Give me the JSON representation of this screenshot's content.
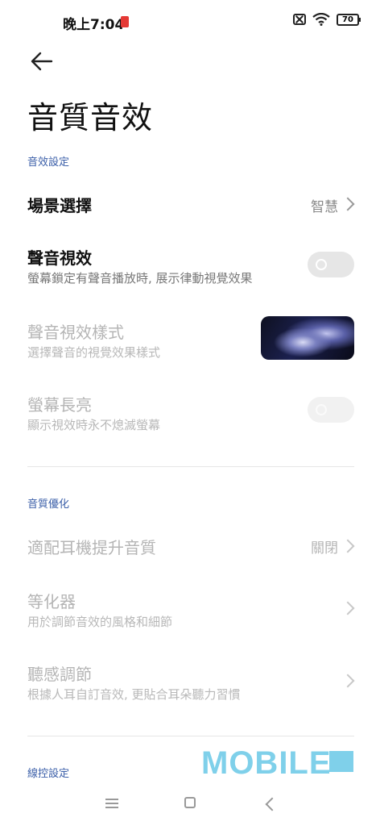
{
  "status": {
    "time": "晚上7:04",
    "battery": "70"
  },
  "title": "音質音效",
  "sections": {
    "effects": "音效設定",
    "quality": "音質優化",
    "wire": "線控設定"
  },
  "scene": {
    "label": "場景選擇",
    "value": "智慧"
  },
  "visual": {
    "label": "聲音視效",
    "sub": "螢幕鎖定有聲音播放時, 展示律動視覺效果"
  },
  "visual_style": {
    "label": "聲音視效樣式",
    "sub": "選擇聲音的視覺效果樣式"
  },
  "screen_on": {
    "label": "螢幕長亮",
    "sub": "顯示視效時永不熄滅螢幕"
  },
  "headphone": {
    "label": "適配耳機提升音質",
    "value": "關閉"
  },
  "equalizer": {
    "label": "等化器",
    "sub": "用於調節音效的風格和細節"
  },
  "hearing": {
    "label": "聽感調節",
    "sub": "根據人耳自訂音效, 更貼合耳朵聽力習慣"
  },
  "watermark": "MOBILE"
}
